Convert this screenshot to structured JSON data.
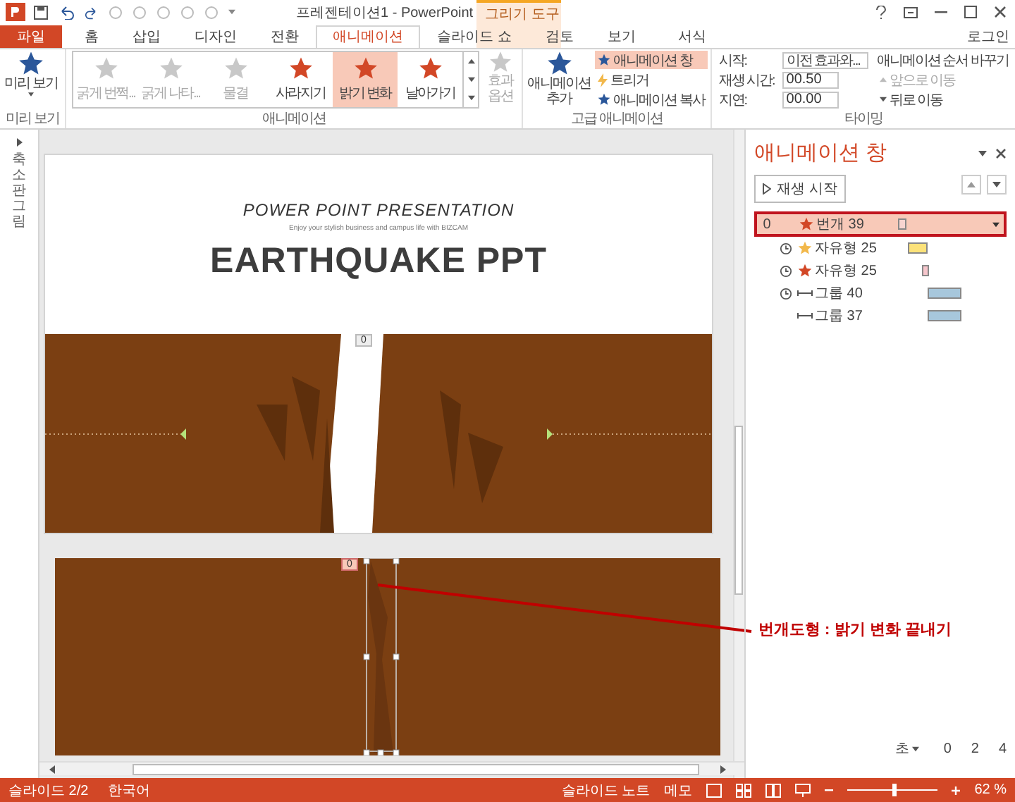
{
  "window": {
    "title": "프레젠테이션1 - PowerPoint",
    "context_group": "그리기 도구",
    "signin": "로그인"
  },
  "tabs": [
    {
      "label": "파일",
      "kind": "file",
      "selected": false
    },
    {
      "label": "홈",
      "kind": "normal",
      "selected": false
    },
    {
      "label": "삽입",
      "kind": "normal",
      "selected": false
    },
    {
      "label": "디자인",
      "kind": "normal",
      "selected": false
    },
    {
      "label": "전환",
      "kind": "normal",
      "selected": false
    },
    {
      "label": "애니메이션",
      "kind": "normal",
      "selected": true
    },
    {
      "label": "슬라이드 쇼",
      "kind": "normal",
      "selected": false
    },
    {
      "label": "검토",
      "kind": "normal",
      "selected": false
    },
    {
      "label": "보기",
      "kind": "normal",
      "selected": false
    },
    {
      "label": "서식",
      "kind": "context",
      "selected": false
    }
  ],
  "ribbon": {
    "preview": {
      "button": "미리 보기",
      "group": "미리 보기"
    },
    "gallery": [
      {
        "label": "굵게 번쩍...",
        "disabled": true,
        "selected": false
      },
      {
        "label": "굵게 나타...",
        "disabled": true,
        "selected": false
      },
      {
        "label": "물결",
        "disabled": true,
        "selected": false
      },
      {
        "label": "사라지기",
        "disabled": false,
        "selected": false
      },
      {
        "label": "밝기 변화",
        "disabled": false,
        "selected": true
      },
      {
        "label": "날아가기",
        "disabled": false,
        "selected": false
      }
    ],
    "gallery_group": "애니메이션",
    "effect_options": [
      "효과",
      "옵션"
    ],
    "advanced": {
      "add": [
        "애니메이션",
        "추가"
      ],
      "pane": {
        "label": "애니메이션 창",
        "selected": true
      },
      "trigger": "트리거",
      "copy": "애니메이션 복사",
      "group": "고급 애니메이션"
    },
    "timing": {
      "start_label": "시작:",
      "start_value": "이전 효과와...",
      "duration_label": "재생 시간:",
      "duration": "00.50",
      "delay_label": "지연:",
      "delay": "00.00",
      "reorder": "애니메이션 순서 바꾸기",
      "forward": {
        "label": "앞으로 이동",
        "disabled": true
      },
      "backward": {
        "label": "뒤로 이동",
        "disabled": false
      },
      "group": "타이밍"
    }
  },
  "slide": {
    "title": "POWER POINT PRESENTATION",
    "subtitle": "Enjoy your stylish business and campus life with BIZCAM",
    "heading": "EARTHQUAKE PPT",
    "tag": "0"
  },
  "second_slide": {
    "tag": "0"
  },
  "annotation": "번개도형 : 밝기 변화 끝내기",
  "thumbnail_pane": {
    "label": "축소판그림"
  },
  "animation_pane": {
    "title": "애니메이션 창",
    "play": "재생 시작",
    "items": [
      {
        "number": "0",
        "clock": false,
        "kind": "exit",
        "name": "번개 39",
        "selected": true,
        "color": "#f7d4d0"
      },
      {
        "clock": true,
        "kind": "emphasis",
        "name": "자유형 25",
        "selected": false,
        "color": "#fce27a"
      },
      {
        "clock": true,
        "kind": "exit",
        "name": "자유형 25",
        "selected": false,
        "color": "#f7c6cc"
      },
      {
        "clock": true,
        "kind": "motion",
        "name": "그룹 40",
        "selected": false,
        "color": "#a7c7dc"
      },
      {
        "clock": false,
        "kind": "motion",
        "name": "그룹 37",
        "selected": false,
        "color": "#a7c7dc"
      }
    ],
    "seconds": "초",
    "ticks": [
      "0",
      "2",
      "4"
    ]
  },
  "status": {
    "slide": "슬라이드 2/2",
    "language": "한국어",
    "notes": "슬라이드 노트",
    "comments": "메모",
    "zoom": "62 %",
    "level": 0.5
  }
}
